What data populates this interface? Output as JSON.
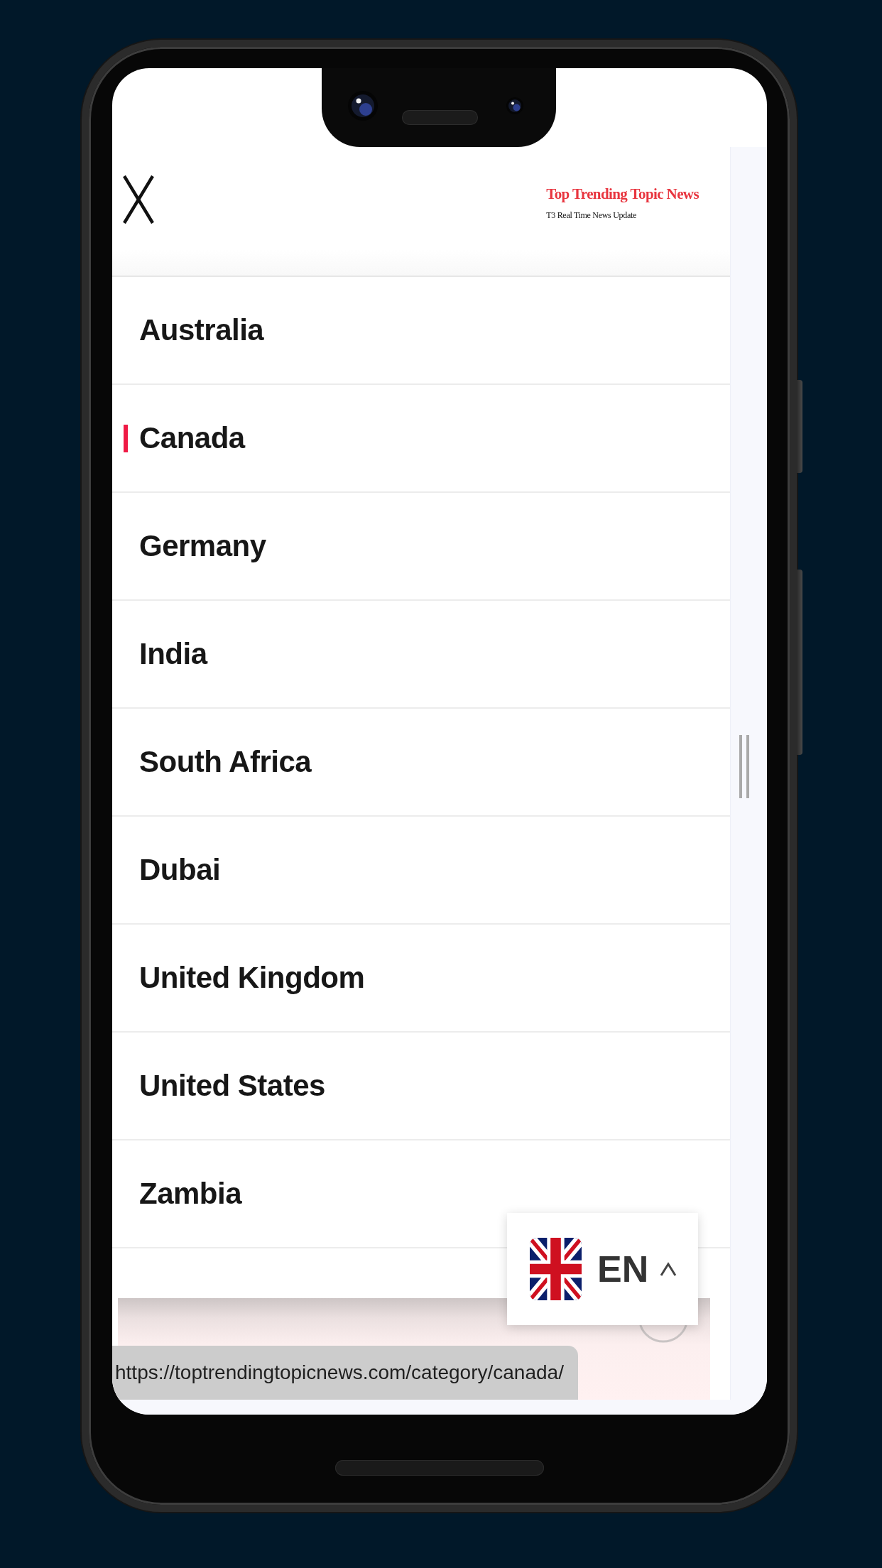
{
  "header": {
    "logo_title": "Top Trending Topic News",
    "logo_tagline": "T3 Real Time News Update"
  },
  "menu": {
    "items": [
      {
        "label": "Australia",
        "selected": false
      },
      {
        "label": "Canada",
        "selected": true
      },
      {
        "label": "Germany",
        "selected": false
      },
      {
        "label": "India",
        "selected": false
      },
      {
        "label": "South Africa",
        "selected": false
      },
      {
        "label": "Dubai",
        "selected": false
      },
      {
        "label": "United Kingdom",
        "selected": false
      },
      {
        "label": "United States",
        "selected": false
      },
      {
        "label": "Zambia",
        "selected": false
      }
    ]
  },
  "language_switcher": {
    "code": "EN"
  },
  "link_preview": {
    "url": "https://toptrendingtopicnews.com/category/canada/"
  }
}
